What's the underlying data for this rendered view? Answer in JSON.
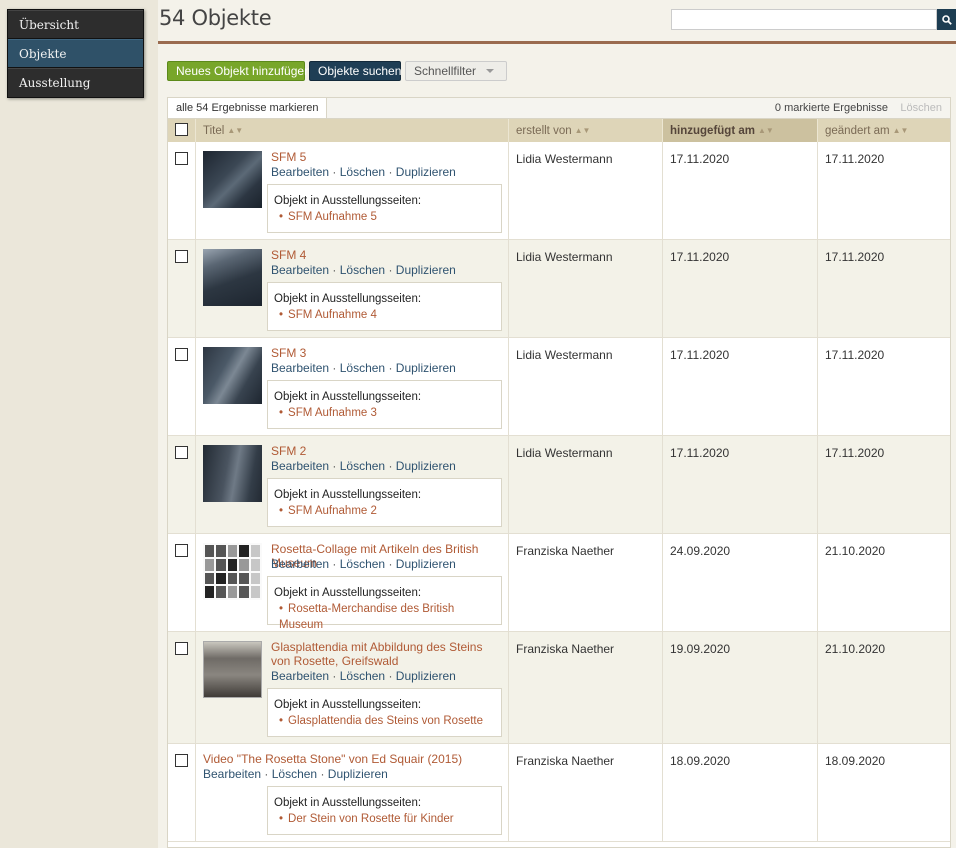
{
  "nav": {
    "items": [
      {
        "label": "Übersicht"
      },
      {
        "label": "Objekte"
      },
      {
        "label": "Ausstellung"
      }
    ]
  },
  "header": {
    "title": "54 Objekte",
    "search_placeholder": ""
  },
  "toolbar": {
    "add_label": "Neues Objekt hinzufügen",
    "search_label": "Objekte suchen",
    "filter_label": "Schnellfilter"
  },
  "batch": {
    "select_all": "alle 54 Ergebnisse markieren",
    "marked_count": "0 markierte Ergebnisse",
    "delete_label": "Löschen"
  },
  "table": {
    "columns": [
      "Titel",
      "erstellt von",
      "hinzugefügt am",
      "geändert am"
    ],
    "action_labels": {
      "edit": "Bearbeiten",
      "delete": "Löschen",
      "duplicate": "Duplizieren",
      "separator": "·"
    },
    "exhibit_label": "Objekt in Ausstellungsseiten:",
    "rows": [
      {
        "title": "SFM 5",
        "creator": "Lidia Westermann",
        "added": "17.11.2020",
        "modified": "17.11.2020",
        "exhibit": "SFM Aufnahme 5"
      },
      {
        "title": "SFM 4",
        "creator": "Lidia Westermann",
        "added": "17.11.2020",
        "modified": "17.11.2020",
        "exhibit": "SFM Aufnahme 4"
      },
      {
        "title": "SFM 3",
        "creator": "Lidia Westermann",
        "added": "17.11.2020",
        "modified": "17.11.2020",
        "exhibit": "SFM Aufnahme 3"
      },
      {
        "title": "SFM 2",
        "creator": "Lidia Westermann",
        "added": "17.11.2020",
        "modified": "17.11.2020",
        "exhibit": "SFM Aufnahme 2"
      },
      {
        "title": "Rosetta-Collage mit Artikeln des British Museum",
        "creator": "Franziska Naether",
        "added": "24.09.2020",
        "modified": "21.10.2020",
        "exhibit": "Rosetta-Merchandise des British Museum"
      },
      {
        "title": "Glasplattendia mit Abbildung des Steins von Rosette, Greifswald",
        "creator": "Franziska Naether",
        "added": "19.09.2020",
        "modified": "21.10.2020",
        "exhibit": "Glasplattendia des Steins von Rosette"
      },
      {
        "title": "Video \"The Rosetta Stone\" von Ed Squair (2015)",
        "creator": "Franziska Naether",
        "added": "18.09.2020",
        "modified": "18.09.2020",
        "exhibit": "Der Stein von Rosette für Kinder"
      }
    ]
  },
  "colors": {
    "accent_green": "#78a62a",
    "accent_navy": "#1f3e55",
    "link_brown": "#b05a35",
    "header_tan": "#ded5b8"
  }
}
